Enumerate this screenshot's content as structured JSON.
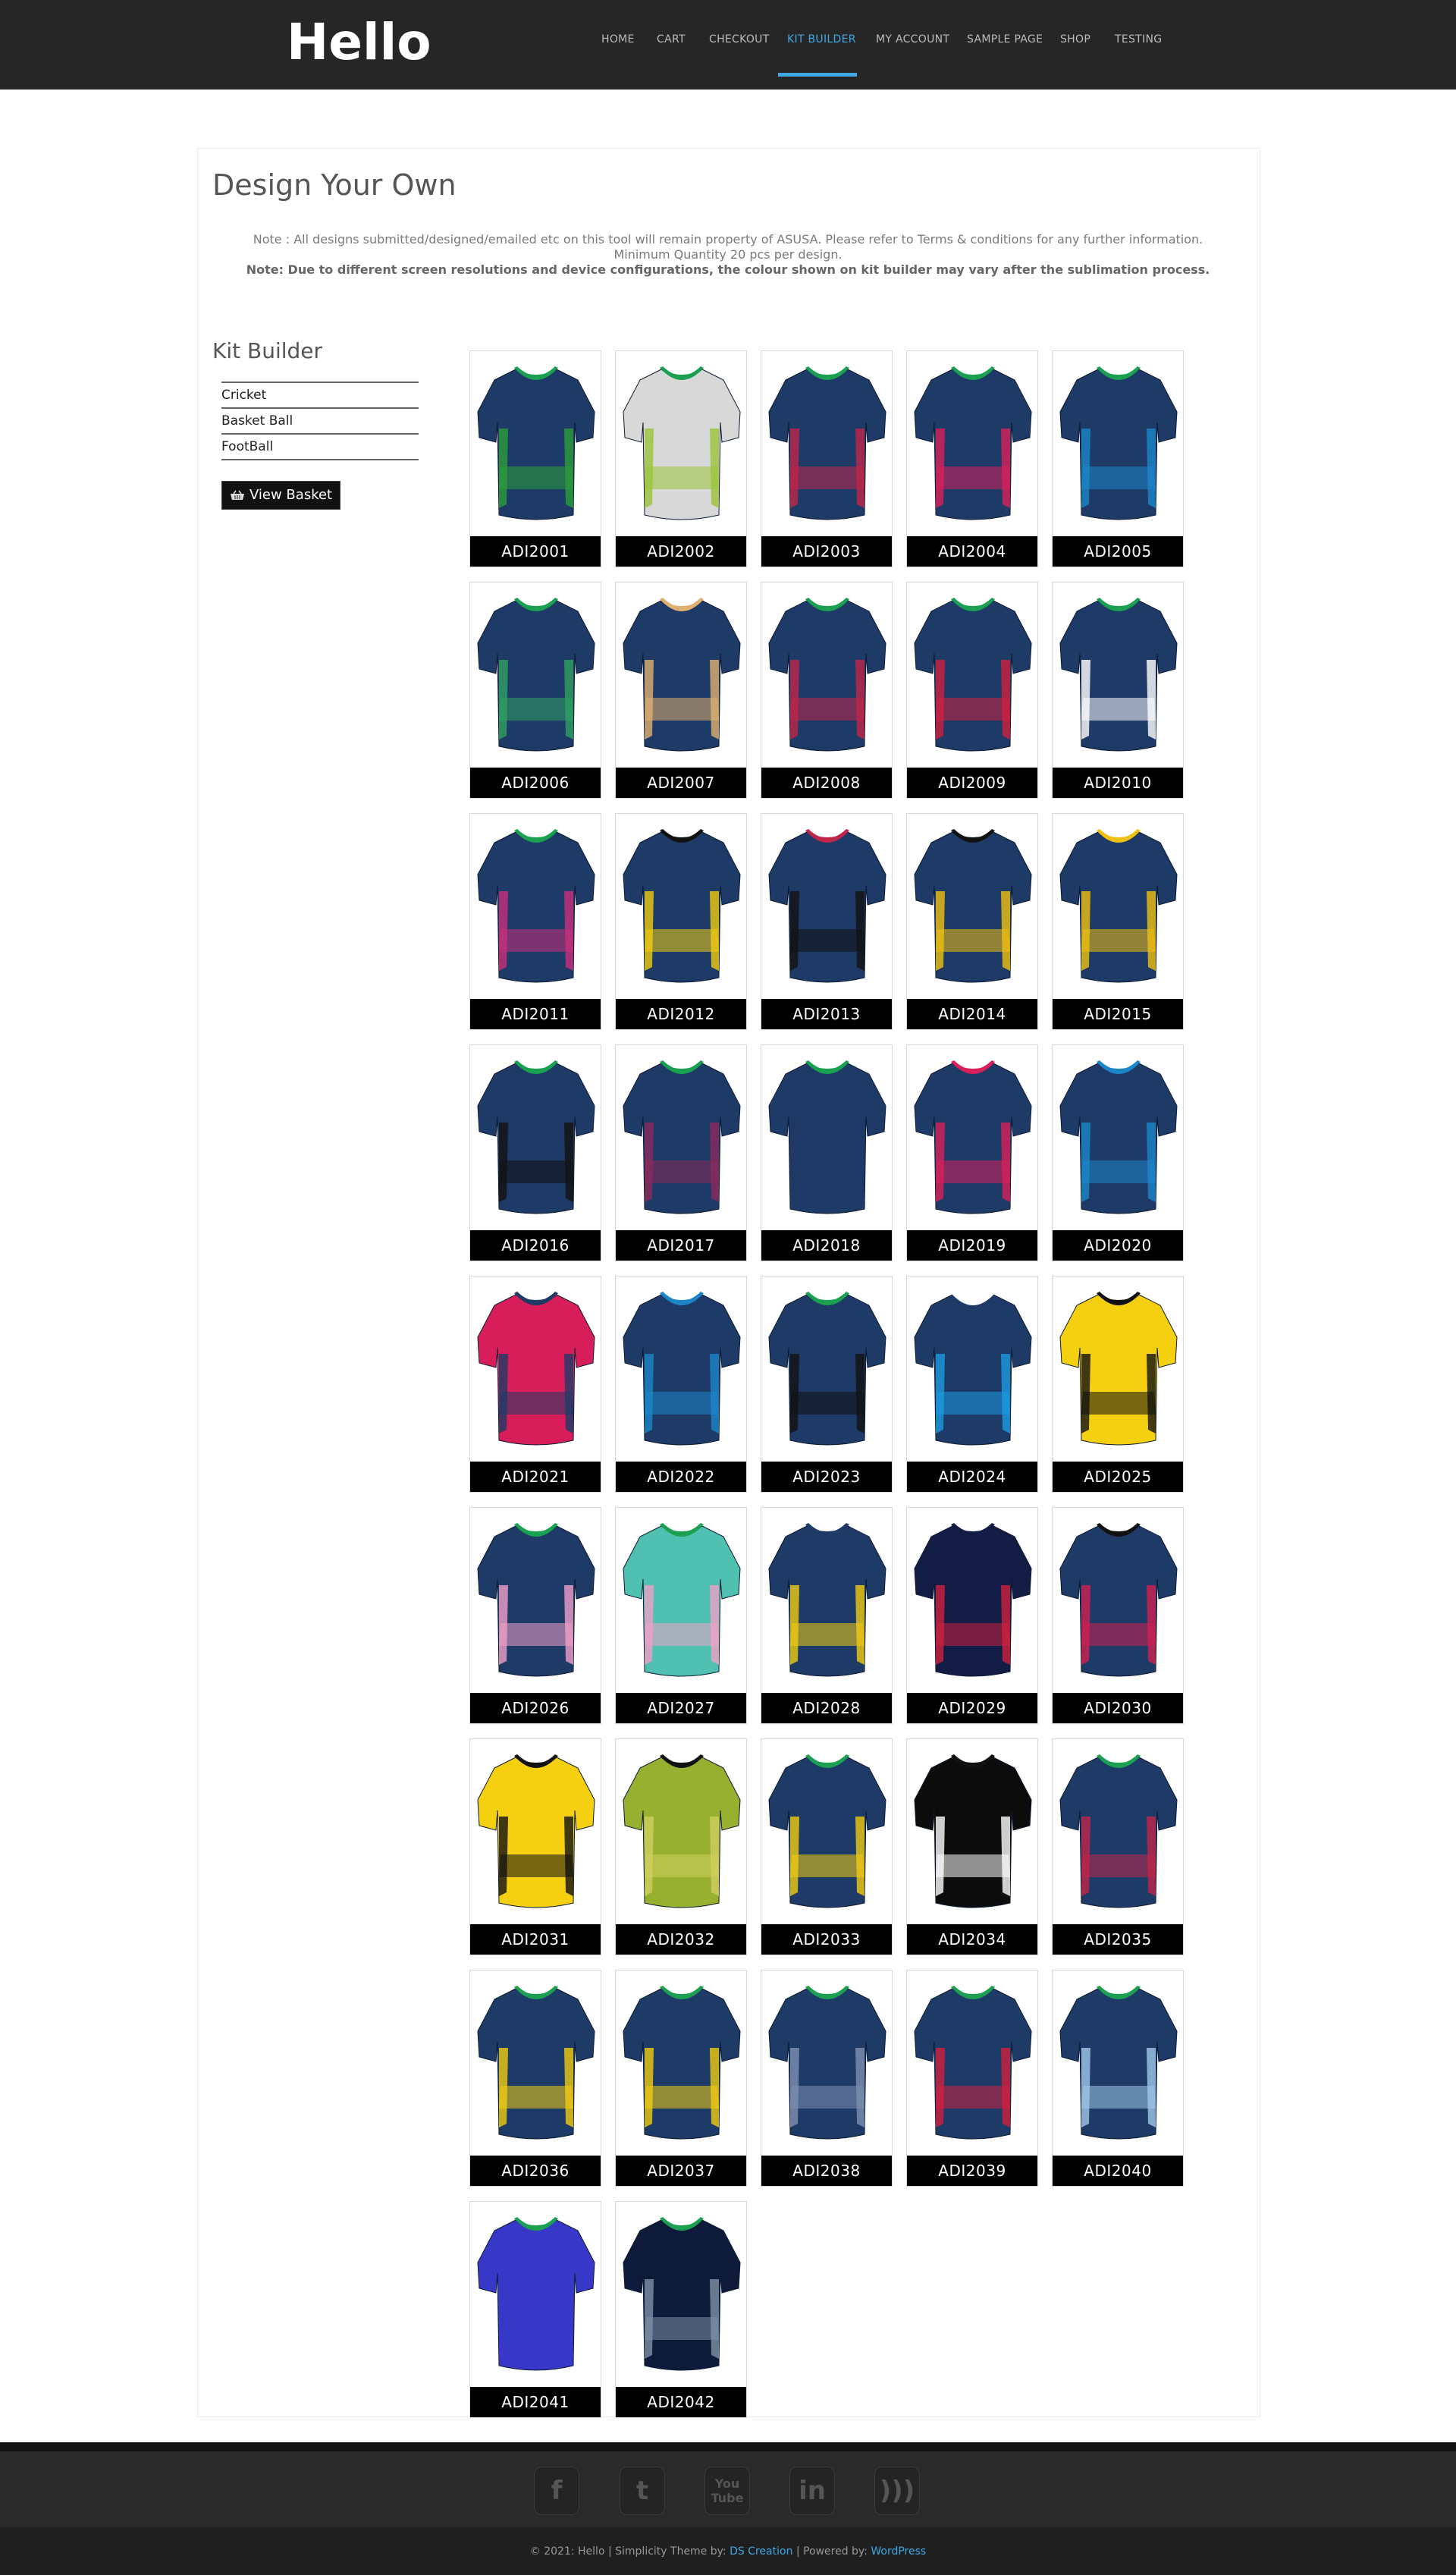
{
  "site": {
    "logo": "Hello"
  },
  "nav": [
    {
      "label": "HOME",
      "active": false
    },
    {
      "label": "CART",
      "active": false
    },
    {
      "label": "CHECKOUT",
      "active": false
    },
    {
      "label": "KIT BUILDER",
      "active": true
    },
    {
      "label": "MY ACCOUNT",
      "active": false
    },
    {
      "label": "SAMPLE PAGE",
      "active": false
    },
    {
      "label": "SHOP",
      "active": false
    },
    {
      "label": "TESTING",
      "active": false
    }
  ],
  "page": {
    "title": "Design Your Own",
    "note_line1": "Note : All designs submitted/designed/emailed etc on this tool will remain property of ASUSA. Please refer to Terms & conditions for any further information.",
    "note_line2": "Minimum Quantity 20 pcs per design.",
    "note_line3": "Note: Due to different screen resolutions and device configurations, the colour shown on kit builder may vary after the sublimation process."
  },
  "sidebar": {
    "title": "Kit Builder",
    "items": [
      {
        "label": "Cricket"
      },
      {
        "label": "Basket Ball"
      },
      {
        "label": "FootBall"
      }
    ],
    "basket_label": "View Basket"
  },
  "designs": [
    {
      "code": "ADI2001",
      "body": "#1e3a66",
      "collar": "#1aa050",
      "accent": "#2a9e3a"
    },
    {
      "code": "ADI2002",
      "body": "#d8d8d8",
      "collar": "#1aa050",
      "accent": "#9bc43a"
    },
    {
      "code": "ADI2003",
      "body": "#1e3a66",
      "collar": "#1aa050",
      "accent": "#c0264a"
    },
    {
      "code": "ADI2004",
      "body": "#1e3a66",
      "collar": "#1aa050",
      "accent": "#d9205a"
    },
    {
      "code": "ADI2005",
      "body": "#1e3a66",
      "collar": "#1aa050",
      "accent": "#1d86c8"
    },
    {
      "code": "ADI2006",
      "body": "#1e3a66",
      "collar": "#1aa050",
      "accent": "#2fa060"
    },
    {
      "code": "ADI2007",
      "body": "#1e3a66",
      "collar": "#e0b070",
      "accent": "#e0b070"
    },
    {
      "code": "ADI2008",
      "body": "#1e3a66",
      "collar": "#1aa050",
      "accent": "#c0264a"
    },
    {
      "code": "ADI2009",
      "body": "#1e3a66",
      "collar": "#1aa050",
      "accent": "#d02040"
    },
    {
      "code": "ADI2010",
      "body": "#1e3a66",
      "collar": "#1aa050",
      "accent": "#ffffff"
    },
    {
      "code": "ADI2011",
      "body": "#1e3a66",
      "collar": "#1aa050",
      "accent": "#c8307a"
    },
    {
      "code": "ADI2012",
      "body": "#1e3a66",
      "collar": "#111111",
      "accent": "#f0cc10"
    },
    {
      "code": "ADI2013",
      "body": "#1e3a66",
      "collar": "#c0264a",
      "accent": "#111111"
    },
    {
      "code": "ADI2014",
      "body": "#1e3a66",
      "collar": "#111111",
      "accent": "#f0c010"
    },
    {
      "code": "ADI2015",
      "body": "#1e3a66",
      "collar": "#f0c010",
      "accent": "#f0c010"
    },
    {
      "code": "ADI2016",
      "body": "#1e3a66",
      "collar": "#1aa050",
      "accent": "#111111"
    },
    {
      "code": "ADI2017",
      "body": "#1e3a66",
      "collar": "#1aa050",
      "accent": "#8a2a5a"
    },
    {
      "code": "ADI2018",
      "body": "#1e3a66",
      "collar": "#1aa050",
      "accent": "#1e3a66"
    },
    {
      "code": "ADI2019",
      "body": "#1e3a66",
      "collar": "#d9205a",
      "accent": "#d9205a"
    },
    {
      "code": "ADI2020",
      "body": "#1e3a66",
      "collar": "#1d86c8",
      "accent": "#1d86c8"
    },
    {
      "code": "ADI2021",
      "body": "#d81e5a",
      "collar": "#1e3a66",
      "accent": "#1e3a66"
    },
    {
      "code": "ADI2022",
      "body": "#1e3a66",
      "collar": "#1d86c8",
      "accent": "#1d86c8"
    },
    {
      "code": "ADI2023",
      "body": "#1e3a66",
      "collar": "#1aa050",
      "accent": "#111111"
    },
    {
      "code": "ADI2024",
      "body": "#1e3a66",
      "collar": "#ffffff",
      "accent": "#1d9ae0"
    },
    {
      "code": "ADI2025",
      "body": "#f5d010",
      "collar": "#111111",
      "accent": "#111111"
    },
    {
      "code": "ADI2026",
      "body": "#1e3a66",
      "collar": "#1aa050",
      "accent": "#f0a0c8"
    },
    {
      "code": "ADI2027",
      "body": "#50c0b0",
      "collar": "#1aa050",
      "accent": "#f0a0c8"
    },
    {
      "code": "ADI2028",
      "body": "#1e3a66",
      "collar": "#1e3a66",
      "accent": "#f0cc10"
    },
    {
      "code": "ADI2029",
      "body": "#131c44",
      "collar": "#131c44",
      "accent": "#d02040"
    },
    {
      "code": "ADI2030",
      "body": "#1e3a66",
      "collar": "#111111",
      "accent": "#d02050"
    },
    {
      "code": "ADI2031",
      "body": "#f5d010",
      "collar": "#111111",
      "accent": "#111111"
    },
    {
      "code": "ADI2032",
      "body": "#98b030",
      "collar": "#111111",
      "accent": "#d0d060"
    },
    {
      "code": "ADI2033",
      "body": "#1e3a66",
      "collar": "#1aa050",
      "accent": "#f0cc10"
    },
    {
      "code": "ADI2034",
      "body": "#0c0c0c",
      "collar": "#111111",
      "accent": "#ffffff"
    },
    {
      "code": "ADI2035",
      "body": "#1e3a66",
      "collar": "#1aa050",
      "accent": "#c0264a"
    },
    {
      "code": "ADI2036",
      "body": "#1e3a66",
      "collar": "#1aa050",
      "accent": "#f0cc10"
    },
    {
      "code": "ADI2037",
      "body": "#1e3a66",
      "collar": "#1aa050",
      "accent": "#f0cc10"
    },
    {
      "code": "ADI2038",
      "body": "#1e3a66",
      "collar": "#1aa050",
      "accent": "#8090b0"
    },
    {
      "code": "ADI2039",
      "body": "#1e3a66",
      "collar": "#1aa050",
      "accent": "#d02040"
    },
    {
      "code": "ADI2040",
      "body": "#1e3a66",
      "collar": "#1aa050",
      "accent": "#a0c8e8"
    },
    {
      "code": "ADI2041",
      "body": "#3838c8",
      "collar": "#1aa050",
      "accent": "#3838c8"
    },
    {
      "code": "ADI2042",
      "body": "#0e1a3a",
      "collar": "#1aa050",
      "accent": "#8090a8"
    }
  ],
  "footer": {
    "social": [
      {
        "name": "facebook-icon",
        "glyph": "f"
      },
      {
        "name": "twitter-icon",
        "glyph": "t"
      },
      {
        "name": "youtube-icon",
        "glyph": "You Tube"
      },
      {
        "name": "linkedin-icon",
        "glyph": "in"
      },
      {
        "name": "rss-icon",
        "glyph": ")))"
      }
    ],
    "copyright_prefix": "© 2021: Hello | Simplicity Theme by: ",
    "theme_author": "DS Creation",
    "powered_prefix": " | Powered by: ",
    "powered_by": "WordPress"
  }
}
